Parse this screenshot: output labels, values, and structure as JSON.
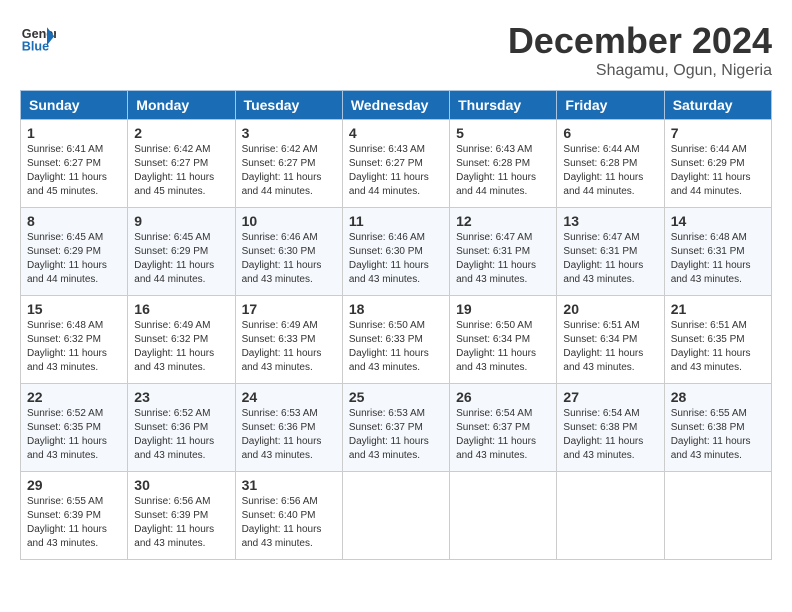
{
  "header": {
    "logo_text_general": "General",
    "logo_text_blue": "Blue",
    "month_year": "December 2024",
    "location": "Shagamu, Ogun, Nigeria"
  },
  "days_of_week": [
    "Sunday",
    "Monday",
    "Tuesday",
    "Wednesday",
    "Thursday",
    "Friday",
    "Saturday"
  ],
  "weeks": [
    [
      {
        "day": "1",
        "info": "Sunrise: 6:41 AM\nSunset: 6:27 PM\nDaylight: 11 hours\nand 45 minutes."
      },
      {
        "day": "2",
        "info": "Sunrise: 6:42 AM\nSunset: 6:27 PM\nDaylight: 11 hours\nand 45 minutes."
      },
      {
        "day": "3",
        "info": "Sunrise: 6:42 AM\nSunset: 6:27 PM\nDaylight: 11 hours\nand 44 minutes."
      },
      {
        "day": "4",
        "info": "Sunrise: 6:43 AM\nSunset: 6:27 PM\nDaylight: 11 hours\nand 44 minutes."
      },
      {
        "day": "5",
        "info": "Sunrise: 6:43 AM\nSunset: 6:28 PM\nDaylight: 11 hours\nand 44 minutes."
      },
      {
        "day": "6",
        "info": "Sunrise: 6:44 AM\nSunset: 6:28 PM\nDaylight: 11 hours\nand 44 minutes."
      },
      {
        "day": "7",
        "info": "Sunrise: 6:44 AM\nSunset: 6:29 PM\nDaylight: 11 hours\nand 44 minutes."
      }
    ],
    [
      {
        "day": "8",
        "info": "Sunrise: 6:45 AM\nSunset: 6:29 PM\nDaylight: 11 hours\nand 44 minutes."
      },
      {
        "day": "9",
        "info": "Sunrise: 6:45 AM\nSunset: 6:29 PM\nDaylight: 11 hours\nand 44 minutes."
      },
      {
        "day": "10",
        "info": "Sunrise: 6:46 AM\nSunset: 6:30 PM\nDaylight: 11 hours\nand 43 minutes."
      },
      {
        "day": "11",
        "info": "Sunrise: 6:46 AM\nSunset: 6:30 PM\nDaylight: 11 hours\nand 43 minutes."
      },
      {
        "day": "12",
        "info": "Sunrise: 6:47 AM\nSunset: 6:31 PM\nDaylight: 11 hours\nand 43 minutes."
      },
      {
        "day": "13",
        "info": "Sunrise: 6:47 AM\nSunset: 6:31 PM\nDaylight: 11 hours\nand 43 minutes."
      },
      {
        "day": "14",
        "info": "Sunrise: 6:48 AM\nSunset: 6:31 PM\nDaylight: 11 hours\nand 43 minutes."
      }
    ],
    [
      {
        "day": "15",
        "info": "Sunrise: 6:48 AM\nSunset: 6:32 PM\nDaylight: 11 hours\nand 43 minutes."
      },
      {
        "day": "16",
        "info": "Sunrise: 6:49 AM\nSunset: 6:32 PM\nDaylight: 11 hours\nand 43 minutes."
      },
      {
        "day": "17",
        "info": "Sunrise: 6:49 AM\nSunset: 6:33 PM\nDaylight: 11 hours\nand 43 minutes."
      },
      {
        "day": "18",
        "info": "Sunrise: 6:50 AM\nSunset: 6:33 PM\nDaylight: 11 hours\nand 43 minutes."
      },
      {
        "day": "19",
        "info": "Sunrise: 6:50 AM\nSunset: 6:34 PM\nDaylight: 11 hours\nand 43 minutes."
      },
      {
        "day": "20",
        "info": "Sunrise: 6:51 AM\nSunset: 6:34 PM\nDaylight: 11 hours\nand 43 minutes."
      },
      {
        "day": "21",
        "info": "Sunrise: 6:51 AM\nSunset: 6:35 PM\nDaylight: 11 hours\nand 43 minutes."
      }
    ],
    [
      {
        "day": "22",
        "info": "Sunrise: 6:52 AM\nSunset: 6:35 PM\nDaylight: 11 hours\nand 43 minutes."
      },
      {
        "day": "23",
        "info": "Sunrise: 6:52 AM\nSunset: 6:36 PM\nDaylight: 11 hours\nand 43 minutes."
      },
      {
        "day": "24",
        "info": "Sunrise: 6:53 AM\nSunset: 6:36 PM\nDaylight: 11 hours\nand 43 minutes."
      },
      {
        "day": "25",
        "info": "Sunrise: 6:53 AM\nSunset: 6:37 PM\nDaylight: 11 hours\nand 43 minutes."
      },
      {
        "day": "26",
        "info": "Sunrise: 6:54 AM\nSunset: 6:37 PM\nDaylight: 11 hours\nand 43 minutes."
      },
      {
        "day": "27",
        "info": "Sunrise: 6:54 AM\nSunset: 6:38 PM\nDaylight: 11 hours\nand 43 minutes."
      },
      {
        "day": "28",
        "info": "Sunrise: 6:55 AM\nSunset: 6:38 PM\nDaylight: 11 hours\nand 43 minutes."
      }
    ],
    [
      {
        "day": "29",
        "info": "Sunrise: 6:55 AM\nSunset: 6:39 PM\nDaylight: 11 hours\nand 43 minutes."
      },
      {
        "day": "30",
        "info": "Sunrise: 6:56 AM\nSunset: 6:39 PM\nDaylight: 11 hours\nand 43 minutes."
      },
      {
        "day": "31",
        "info": "Sunrise: 6:56 AM\nSunset: 6:40 PM\nDaylight: 11 hours\nand 43 minutes."
      },
      {
        "day": "",
        "info": ""
      },
      {
        "day": "",
        "info": ""
      },
      {
        "day": "",
        "info": ""
      },
      {
        "day": "",
        "info": ""
      }
    ]
  ]
}
